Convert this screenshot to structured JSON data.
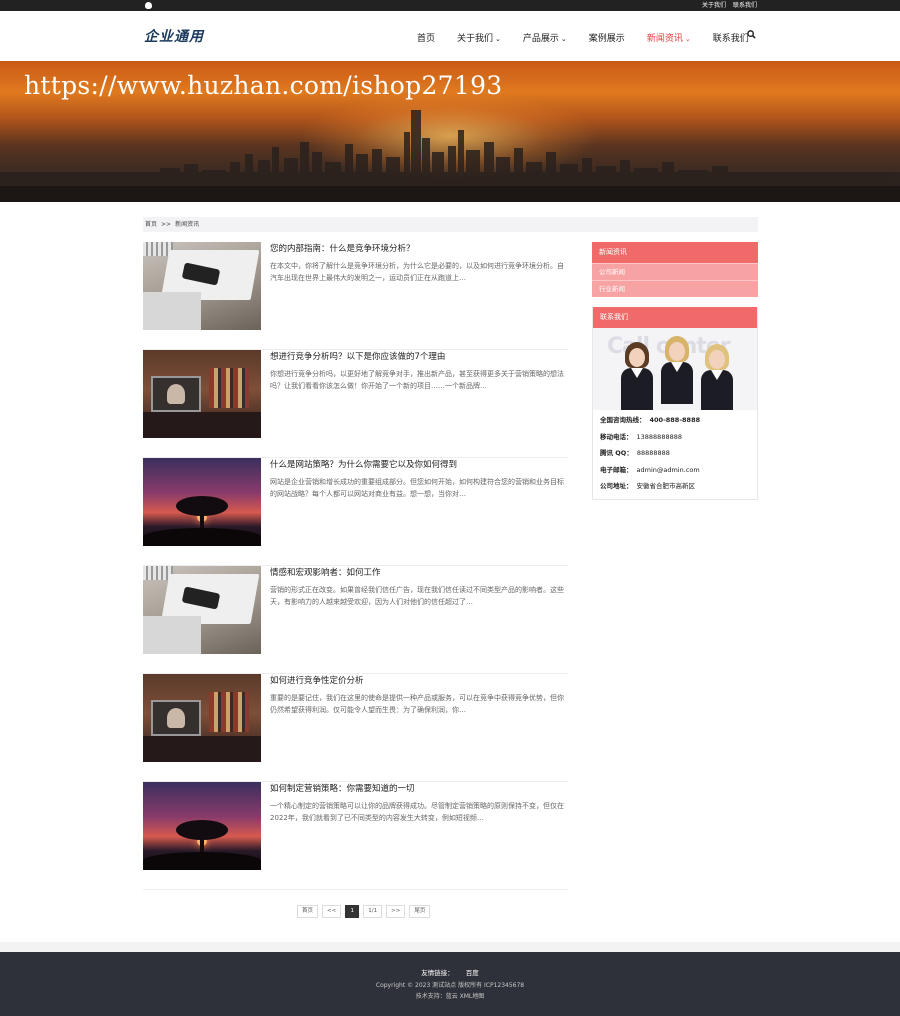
{
  "topbar": {
    "links": [
      "关于我们",
      "联系我们"
    ]
  },
  "header": {
    "brand": "企业通用",
    "nav": [
      {
        "label": "首页",
        "caret": ""
      },
      {
        "label": "关于我们",
        "caret": "⌄"
      },
      {
        "label": "产品展示",
        "caret": "⌄"
      },
      {
        "label": "案例展示",
        "caret": ""
      },
      {
        "label": "新闻资讯",
        "caret": "⌄",
        "active": true
      },
      {
        "label": "联系我们",
        "caret": ""
      }
    ]
  },
  "banner": {
    "watermark": "https://www.huzhan.com/ishop27193"
  },
  "breadcrumb": {
    "home": "首页",
    "sep": ">>",
    "current": "新闻资讯"
  },
  "posts": [
    {
      "title": "您的内部指南：什么是竞争环境分析？",
      "excerpt": "在本文中，你将了解什么是竞争环境分析，为什么它是必要的，以及如何进行竞争环境分析。自汽车出现在世界上最伟大的发明之一，运动员们正在从跑道上…",
      "thumb": "laptop"
    },
    {
      "title": "想进行竞争分析吗？以下是你应该做的7个理由",
      "excerpt": "你想进行竞争分析吗，以更好地了解竞争对手，推出新产品，甚至获得更多关于营销策略的想法吗？让我们看看你该怎么做！你开始了一个新的项目……一个新品牌…",
      "thumb": "desk"
    },
    {
      "title": "什么是网站策略？为什么你需要它以及你如何得到",
      "excerpt": "网站是企业营销和增长成功的重要组成部分。但您如何开始，如何构建符合您的营销和业务目标的网站战略？每个人都可以网站对商业有益。想一想，当你对…",
      "thumb": "tree"
    },
    {
      "title": "情感和宏观影响者：如何工作",
      "excerpt": "营销的形式正在改变。如果曾经我们信任广告，现在我们信任读过不同类型产品的影响者。这些天，有影响力的人越来越受欢迎，因为人们对他们的信任超过了…",
      "thumb": "laptop"
    },
    {
      "title": "如何进行竞争性定价分析",
      "excerpt": "重要的是要记住，我们在这里的使命是提供一种产品或服务，可以在竞争中获得竞争优势，但你仍然希望获得利润。仅可能令人望而生畏：为了确保利润，你…",
      "thumb": "desk"
    },
    {
      "title": "如何制定营销策略：你需要知道的一切",
      "excerpt": "一个精心制定的营销策略可以让你的品牌获得成功。尽管制定营销策略的原则保持不变，但仅在2022年，我们就看到了已不同类型的内容发生大转变，例如短视频…",
      "thumb": "tree"
    }
  ],
  "sidebar": {
    "news_title": "新闻资讯",
    "news_items": [
      "公司新闻",
      "行业新闻"
    ],
    "contact_title": "联系我们",
    "contact_image_text": "Call center",
    "contact_rows": [
      {
        "label": "全国咨询热线：",
        "value": "400-888-8888"
      },
      {
        "label": "移动电话：",
        "value": "13888888888"
      },
      {
        "label": "腾讯 QQ：",
        "value": "88888888"
      },
      {
        "label": "电子邮箱：",
        "value": "admin@admin.com"
      },
      {
        "label": "公司地址：",
        "value": "安徽省合肥市高新区"
      }
    ]
  },
  "pagination": {
    "first": "首页",
    "prev": "<<",
    "current": "1",
    "info": "1/1",
    "next": ">>",
    "last": "尾页"
  },
  "footer": {
    "links_label": "友情链接：",
    "links": [
      "百度"
    ],
    "copyright": "Copyright © 2023 测试站点 版权所有 ICP12345678",
    "tech": "技术支持：蓝云 XML地图"
  },
  "colors": {
    "accent": "#e33b3b",
    "sidebar_head": "#f06a6a",
    "sidebar_sub": "#f7a3a3",
    "footer_bg": "#2e3139"
  }
}
